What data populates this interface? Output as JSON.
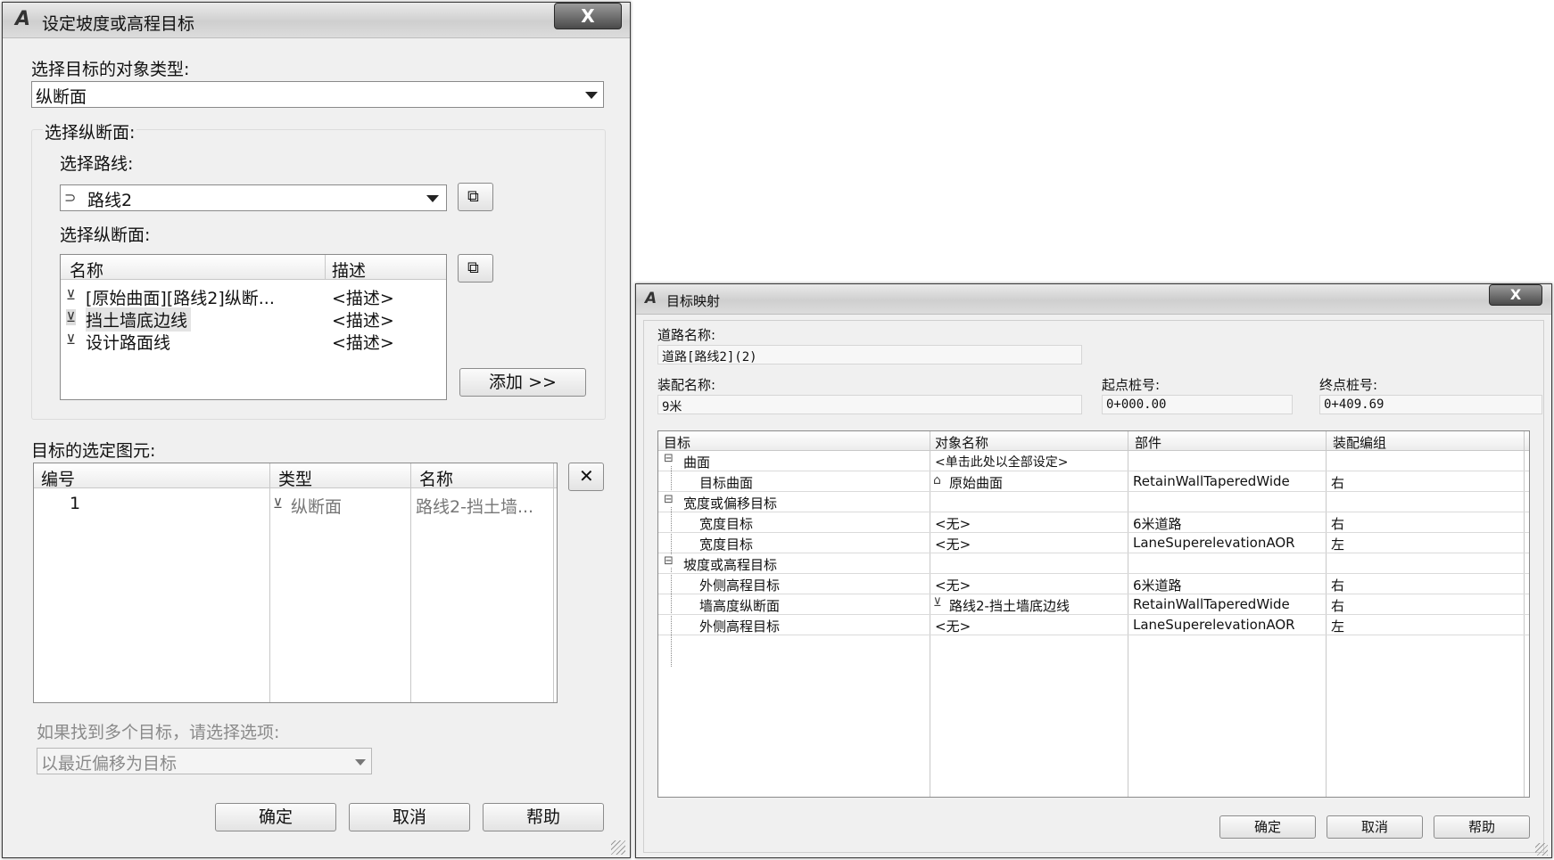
{
  "dialog1": {
    "title": "设定坡度或高程目标",
    "object_type_label": "选择目标的对象类型:",
    "object_type_value": "纵断面",
    "profile_group_label": "选择纵断面:",
    "alignment_label": "选择路线:",
    "alignment_value": "路线2",
    "profile_label": "选择纵断面:",
    "profile_list": {
      "columns": [
        "名称",
        "描述"
      ],
      "rows": [
        {
          "name": "[原始曲面][路线2]纵断...",
          "desc": "<描述>"
        },
        {
          "name": "挡土墙底边线",
          "desc": "<描述>"
        },
        {
          "name": "设计路面线",
          "desc": "<描述>"
        }
      ]
    },
    "add_button": "添加 >>",
    "selected_label": "目标的选定图元:",
    "selected_list": {
      "columns": [
        "编号",
        "类型",
        "名称"
      ],
      "rows": [
        {
          "num": "1",
          "type": "纵断面",
          "name": "路线2-挡土墙..."
        }
      ]
    },
    "multi_label": "如果找到多个目标，请选择选项:",
    "multi_value": "以最近偏移为目标",
    "ok": "确定",
    "cancel": "取消",
    "help": "帮助",
    "close": "X"
  },
  "dialog2": {
    "title": "目标映射",
    "corridor_label": "道路名称:",
    "corridor_value": "道路[路线2](2)",
    "assembly_label": "装配名称:",
    "assembly_value": "9米",
    "start_label": "起点桩号:",
    "start_value": "0+000.00",
    "end_label": "终点桩号:",
    "end_value": "0+409.69",
    "grid": {
      "columns": [
        "目标",
        "对象名称",
        "部件",
        "装配编组"
      ],
      "rows": [
        {
          "indent": 0,
          "expander": "⊟",
          "target": "曲面",
          "object": "<单击此处以全部设定>",
          "part": "",
          "group": ""
        },
        {
          "indent": 1,
          "expander": "",
          "target": "目标曲面",
          "object": "原始曲面",
          "part": "RetainWallTaperedWide",
          "group": "右"
        },
        {
          "indent": 0,
          "expander": "⊟",
          "target": "宽度或偏移目标",
          "object": "",
          "part": "",
          "group": ""
        },
        {
          "indent": 1,
          "expander": "",
          "target": "宽度目标",
          "object": "<无>",
          "part": "6米道路",
          "group": "右"
        },
        {
          "indent": 1,
          "expander": "",
          "target": "宽度目标",
          "object": "<无>",
          "part": "LaneSuperelevationAOR",
          "group": "左"
        },
        {
          "indent": 0,
          "expander": "⊟",
          "target": "坡度或高程目标",
          "object": "",
          "part": "",
          "group": ""
        },
        {
          "indent": 1,
          "expander": "",
          "target": "外侧高程目标",
          "object": "<无>",
          "part": "6米道路",
          "group": "右"
        },
        {
          "indent": 1,
          "expander": "",
          "target": "墙高度纵断面",
          "object": "路线2-挡土墙底边线",
          "part": "RetainWallTaperedWide",
          "group": "右"
        },
        {
          "indent": 1,
          "expander": "",
          "target": "外侧高程目标",
          "object": "<无>",
          "part": "LaneSuperelevationAOR",
          "group": "左"
        }
      ]
    },
    "ok": "确定",
    "cancel": "取消",
    "help": "帮助",
    "close": "X"
  }
}
